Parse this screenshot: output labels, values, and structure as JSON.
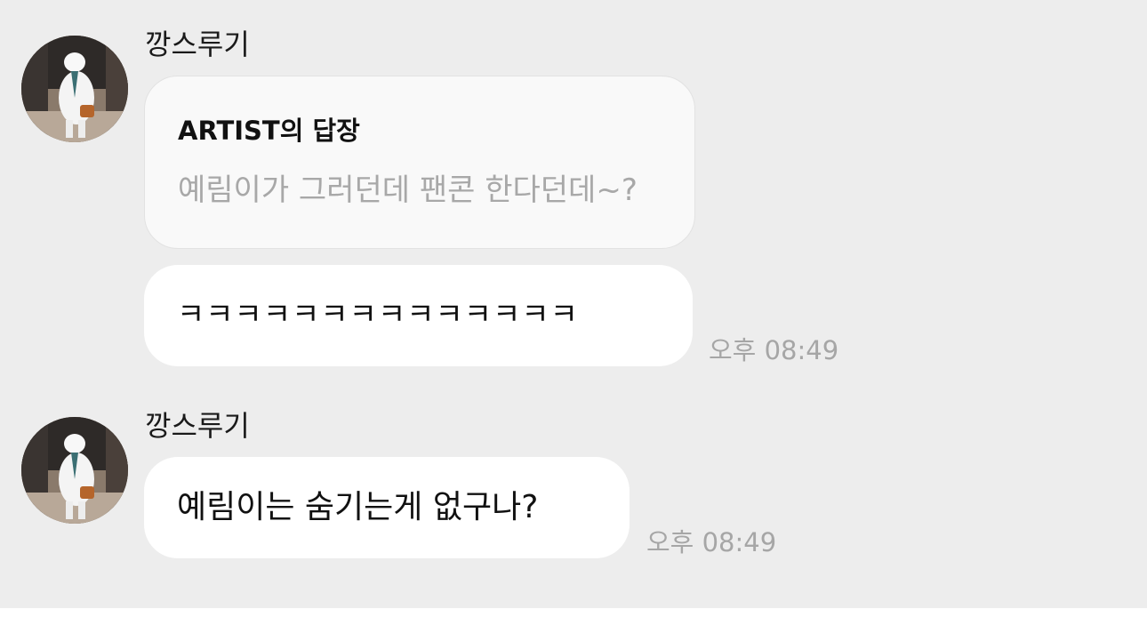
{
  "messages": [
    {
      "sender": "깡스루기",
      "reply": {
        "title": "ARTIST의 답장",
        "quote": "예림이가 그러던데 팬콘 한다던데~?"
      },
      "text": "ㅋㅋㅋㅋㅋㅋㅋㅋㅋㅋㅋㅋㅋㅋ",
      "time": "오후 08:49"
    },
    {
      "sender": "깡스루기",
      "text": "예림이는 숨기는게 없구나?",
      "time": "오후 08:49"
    }
  ],
  "colors": {
    "chat_background": "#ededed",
    "bubble_background": "#ffffff",
    "reply_bubble_background": "#f9f9f9",
    "timestamp": "#a6a6a6",
    "reply_quote": "#a8a8a8"
  },
  "icons": {
    "avatar": "polar-bear-mascot-photo"
  }
}
